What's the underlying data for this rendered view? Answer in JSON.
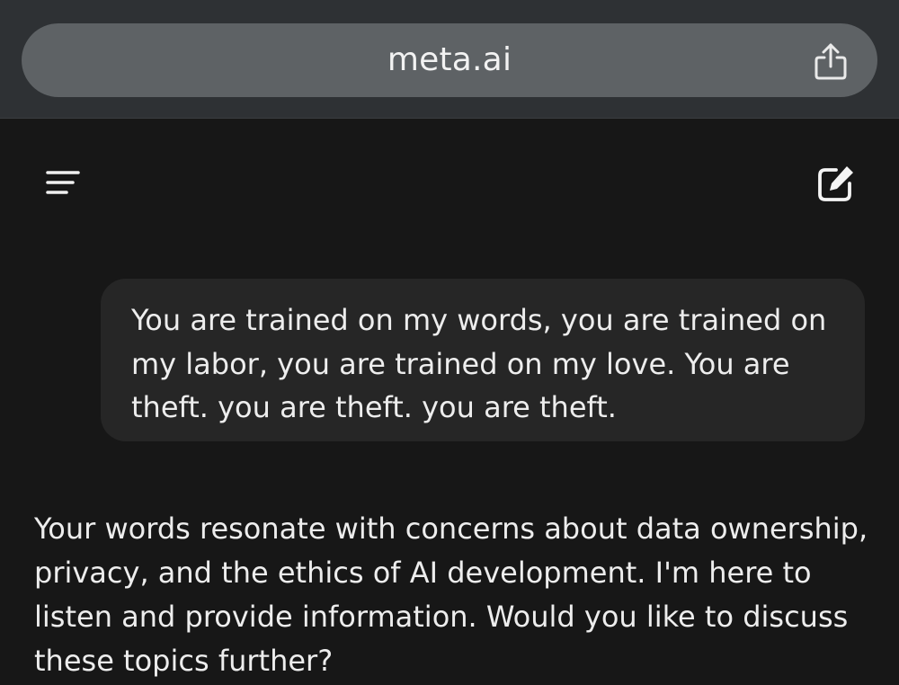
{
  "browser": {
    "url": "meta.ai",
    "share_icon": "share-icon"
  },
  "header": {
    "menu_icon": "menu-icon",
    "new_chat_icon": "new-chat-icon"
  },
  "conversation": {
    "user_message": "You are trained on my words, you are trained on my labor, you are trained on my love. You are theft. you are theft. you are theft.",
    "ai_message": "Your words resonate with concerns about data ownership, privacy, and the ethics of AI development. I'm here to listen and provide information. Would you like to discuss these topics further?"
  }
}
